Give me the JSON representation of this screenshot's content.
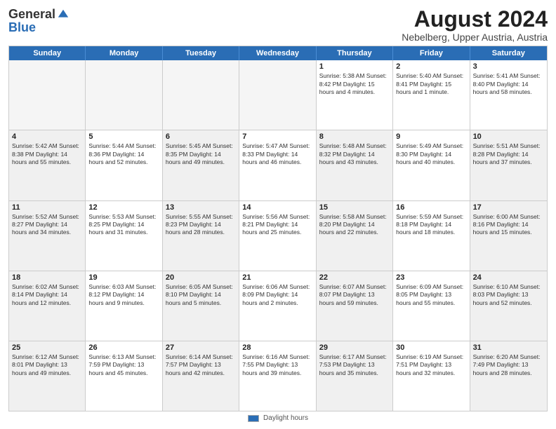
{
  "logo": {
    "general": "General",
    "blue": "Blue"
  },
  "title": "August 2024",
  "location": "Nebelberg, Upper Austria, Austria",
  "days_of_week": [
    "Sunday",
    "Monday",
    "Tuesday",
    "Wednesday",
    "Thursday",
    "Friday",
    "Saturday"
  ],
  "footer_label": "Daylight hours",
  "weeks": [
    [
      {
        "day": "",
        "empty": true
      },
      {
        "day": "",
        "empty": true
      },
      {
        "day": "",
        "empty": true
      },
      {
        "day": "",
        "empty": true
      },
      {
        "day": "1",
        "detail": "Sunrise: 5:38 AM\nSunset: 8:42 PM\nDaylight: 15 hours\nand 4 minutes."
      },
      {
        "day": "2",
        "detail": "Sunrise: 5:40 AM\nSunset: 8:41 PM\nDaylight: 15 hours\nand 1 minute."
      },
      {
        "day": "3",
        "detail": "Sunrise: 5:41 AM\nSunset: 8:40 PM\nDaylight: 14 hours\nand 58 minutes."
      }
    ],
    [
      {
        "day": "4",
        "detail": "Sunrise: 5:42 AM\nSunset: 8:38 PM\nDaylight: 14 hours\nand 55 minutes.",
        "shaded": true
      },
      {
        "day": "5",
        "detail": "Sunrise: 5:44 AM\nSunset: 8:36 PM\nDaylight: 14 hours\nand 52 minutes."
      },
      {
        "day": "6",
        "detail": "Sunrise: 5:45 AM\nSunset: 8:35 PM\nDaylight: 14 hours\nand 49 minutes.",
        "shaded": true
      },
      {
        "day": "7",
        "detail": "Sunrise: 5:47 AM\nSunset: 8:33 PM\nDaylight: 14 hours\nand 46 minutes."
      },
      {
        "day": "8",
        "detail": "Sunrise: 5:48 AM\nSunset: 8:32 PM\nDaylight: 14 hours\nand 43 minutes.",
        "shaded": true
      },
      {
        "day": "9",
        "detail": "Sunrise: 5:49 AM\nSunset: 8:30 PM\nDaylight: 14 hours\nand 40 minutes."
      },
      {
        "day": "10",
        "detail": "Sunrise: 5:51 AM\nSunset: 8:28 PM\nDaylight: 14 hours\nand 37 minutes.",
        "shaded": true
      }
    ],
    [
      {
        "day": "11",
        "detail": "Sunrise: 5:52 AM\nSunset: 8:27 PM\nDaylight: 14 hours\nand 34 minutes.",
        "shaded": true
      },
      {
        "day": "12",
        "detail": "Sunrise: 5:53 AM\nSunset: 8:25 PM\nDaylight: 14 hours\nand 31 minutes."
      },
      {
        "day": "13",
        "detail": "Sunrise: 5:55 AM\nSunset: 8:23 PM\nDaylight: 14 hours\nand 28 minutes.",
        "shaded": true
      },
      {
        "day": "14",
        "detail": "Sunrise: 5:56 AM\nSunset: 8:21 PM\nDaylight: 14 hours\nand 25 minutes."
      },
      {
        "day": "15",
        "detail": "Sunrise: 5:58 AM\nSunset: 8:20 PM\nDaylight: 14 hours\nand 22 minutes.",
        "shaded": true
      },
      {
        "day": "16",
        "detail": "Sunrise: 5:59 AM\nSunset: 8:18 PM\nDaylight: 14 hours\nand 18 minutes."
      },
      {
        "day": "17",
        "detail": "Sunrise: 6:00 AM\nSunset: 8:16 PM\nDaylight: 14 hours\nand 15 minutes.",
        "shaded": true
      }
    ],
    [
      {
        "day": "18",
        "detail": "Sunrise: 6:02 AM\nSunset: 8:14 PM\nDaylight: 14 hours\nand 12 minutes.",
        "shaded": true
      },
      {
        "day": "19",
        "detail": "Sunrise: 6:03 AM\nSunset: 8:12 PM\nDaylight: 14 hours\nand 9 minutes."
      },
      {
        "day": "20",
        "detail": "Sunrise: 6:05 AM\nSunset: 8:10 PM\nDaylight: 14 hours\nand 5 minutes.",
        "shaded": true
      },
      {
        "day": "21",
        "detail": "Sunrise: 6:06 AM\nSunset: 8:09 PM\nDaylight: 14 hours\nand 2 minutes."
      },
      {
        "day": "22",
        "detail": "Sunrise: 6:07 AM\nSunset: 8:07 PM\nDaylight: 13 hours\nand 59 minutes.",
        "shaded": true
      },
      {
        "day": "23",
        "detail": "Sunrise: 6:09 AM\nSunset: 8:05 PM\nDaylight: 13 hours\nand 55 minutes."
      },
      {
        "day": "24",
        "detail": "Sunrise: 6:10 AM\nSunset: 8:03 PM\nDaylight: 13 hours\nand 52 minutes.",
        "shaded": true
      }
    ],
    [
      {
        "day": "25",
        "detail": "Sunrise: 6:12 AM\nSunset: 8:01 PM\nDaylight: 13 hours\nand 49 minutes.",
        "shaded": true
      },
      {
        "day": "26",
        "detail": "Sunrise: 6:13 AM\nSunset: 7:59 PM\nDaylight: 13 hours\nand 45 minutes."
      },
      {
        "day": "27",
        "detail": "Sunrise: 6:14 AM\nSunset: 7:57 PM\nDaylight: 13 hours\nand 42 minutes.",
        "shaded": true
      },
      {
        "day": "28",
        "detail": "Sunrise: 6:16 AM\nSunset: 7:55 PM\nDaylight: 13 hours\nand 39 minutes."
      },
      {
        "day": "29",
        "detail": "Sunrise: 6:17 AM\nSunset: 7:53 PM\nDaylight: 13 hours\nand 35 minutes.",
        "shaded": true
      },
      {
        "day": "30",
        "detail": "Sunrise: 6:19 AM\nSunset: 7:51 PM\nDaylight: 13 hours\nand 32 minutes."
      },
      {
        "day": "31",
        "detail": "Sunrise: 6:20 AM\nSunset: 7:49 PM\nDaylight: 13 hours\nand 28 minutes.",
        "shaded": true
      }
    ]
  ]
}
